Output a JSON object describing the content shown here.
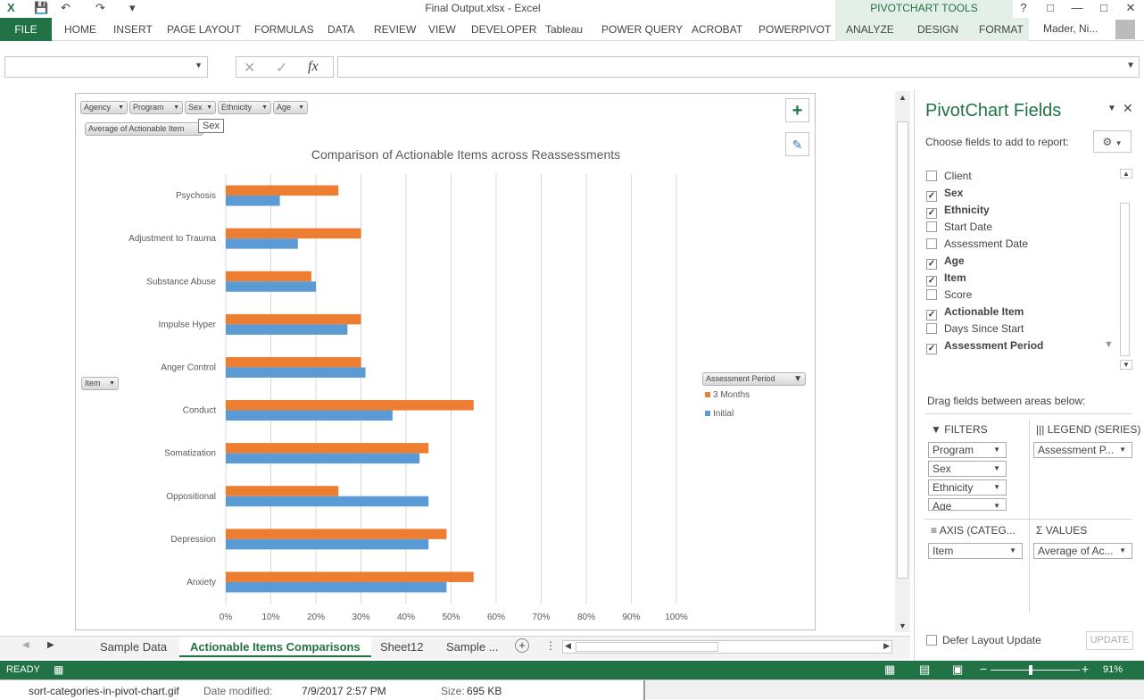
{
  "window": {
    "title": "Final Output.xlsx - Excel",
    "context_group": "PIVOTCHART TOOLS",
    "user": "Mader, Ni..."
  },
  "ribbon": {
    "file_tab": "FILE",
    "tabs": [
      "HOME",
      "INSERT",
      "PAGE LAYOUT",
      "FORMULAS",
      "DATA",
      "REVIEW",
      "VIEW",
      "DEVELOPER",
      "Tableau",
      "POWER QUERY",
      "ACROBAT",
      "POWERPIVOT",
      "ANALYZE",
      "DESIGN",
      "FORMAT"
    ]
  },
  "formula_bar": {
    "name_box": "",
    "fx": "fx",
    "formula": ""
  },
  "chart": {
    "filter_buttons": [
      "Agency",
      "Program",
      "Sex",
      "Ethnicity",
      "Age"
    ],
    "value_button": "Average of Actionable Item",
    "axis_button": "Item",
    "legend_button": "Assessment Period",
    "tooltip": "Sex"
  },
  "chart_data": {
    "type": "bar",
    "title": "Comparison of Actionable Items across Reassessments",
    "orientation": "horizontal",
    "categories": [
      "Psychosis",
      "Adjustment to Trauma",
      "Substance Abuse",
      "Impulse Hyper",
      "Anger Control",
      "Conduct",
      "Somatization",
      "Oppositional",
      "Depression",
      "Anxiety"
    ],
    "series": [
      {
        "name": "3 Months",
        "color": "#ed7d31",
        "values": [
          0.25,
          0.3,
          0.19,
          0.3,
          0.3,
          0.55,
          0.45,
          0.25,
          0.49,
          0.55
        ]
      },
      {
        "name": "Initial",
        "color": "#5b9bd5",
        "values": [
          0.12,
          0.16,
          0.2,
          0.27,
          0.31,
          0.37,
          0.43,
          0.45,
          0.45,
          0.49
        ]
      }
    ],
    "xlim": [
      0,
      1.0
    ],
    "x_ticks": [
      "0%",
      "10%",
      "20%",
      "30%",
      "40%",
      "50%",
      "60%",
      "70%",
      "80%",
      "90%",
      "100%"
    ],
    "grid": true,
    "legend_position": "right"
  },
  "pane": {
    "title": "PivotChart Fields",
    "description": "Choose fields to add to report:",
    "fields": [
      {
        "label": "Client",
        "checked": false
      },
      {
        "label": "Sex",
        "checked": true
      },
      {
        "label": "Ethnicity",
        "checked": true
      },
      {
        "label": "Start Date",
        "checked": false
      },
      {
        "label": "Assessment Date",
        "checked": false
      },
      {
        "label": "Age",
        "checked": true
      },
      {
        "label": "Item",
        "checked": true
      },
      {
        "label": "Score",
        "checked": false
      },
      {
        "label": "Actionable Item",
        "checked": true
      },
      {
        "label": "Days Since Start",
        "checked": false
      },
      {
        "label": "Assessment Period",
        "checked": true
      }
    ],
    "drag_text": "Drag fields between areas below:",
    "filters_hdr": "FILTERS",
    "legend_hdr": "LEGEND (SERIES)",
    "axis_hdr": "AXIS (CATEG...",
    "values_hdr": "VALUES",
    "filters": [
      "Program",
      "Sex",
      "Ethnicity",
      "Age"
    ],
    "legend_item": "Assessment P...",
    "axis_item": "Item",
    "values_item": "Average of Ac...",
    "defer": "Defer Layout Update",
    "update": "UPDATE"
  },
  "sheets": {
    "tabs": [
      "Sample Data",
      "Actionable Items Comparisons",
      "Sheet12",
      "Sample ..."
    ],
    "active": 1
  },
  "status": {
    "mode": "READY",
    "zoom": "91%"
  },
  "file_strip": {
    "name": "sort-categories-in-pivot-chart.gif",
    "modified_label": "Date modified:",
    "modified": "7/9/2017 2:57 PM",
    "size_label": "Size:",
    "size": "695 KB"
  }
}
